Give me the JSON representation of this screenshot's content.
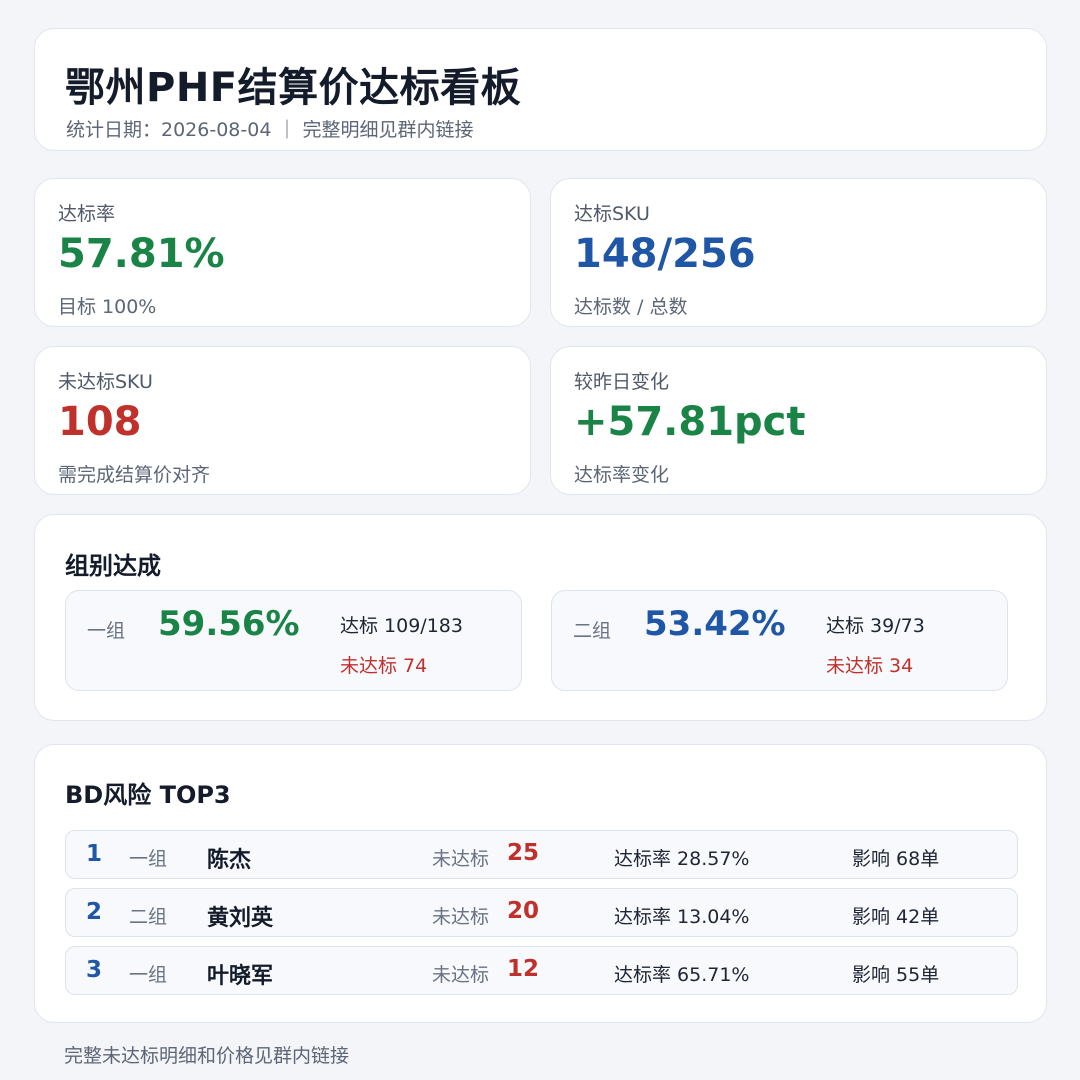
{
  "header": {
    "title": "鄂州PHF结算价达标看板",
    "subtitle": "统计日期：2026-08-04 ｜ 完整明细见群内链接"
  },
  "stats": [
    {
      "label": "达标率",
      "value": "57.81%",
      "note": "目标 100%",
      "color": "#1a8447"
    },
    {
      "label": "达标SKU",
      "value": "148/256",
      "note": "达标数 / 总数",
      "color": "#1f56a5"
    },
    {
      "label": "未达标SKU",
      "value": "108",
      "note": "需完成结算价对齐",
      "color": "#c0312c"
    },
    {
      "label": "较昨日变化",
      "value": "+57.81pct",
      "note": "达标率变化",
      "color": "#1a8447"
    }
  ],
  "groups": {
    "title": "组别达成",
    "items": [
      {
        "name": "一组",
        "rate": "59.56%",
        "done": "达标 109/183",
        "miss": "未达标 74",
        "color": "#1a8447"
      },
      {
        "name": "二组",
        "rate": "53.42%",
        "done": "达标 39/73",
        "miss": "未达标 34",
        "color": "#1f56a5"
      }
    ]
  },
  "risk": {
    "title": "BD风险 TOP3",
    "miss_label": "未达标",
    "rows": [
      {
        "rank": "1",
        "group": "一组",
        "name": "陈杰",
        "miss": "25",
        "rate": "达标率 28.57%",
        "impact": "影响 68单"
      },
      {
        "rank": "2",
        "group": "二组",
        "name": "黄刘英",
        "miss": "20",
        "rate": "达标率 13.04%",
        "impact": "影响 42单"
      },
      {
        "rank": "3",
        "group": "一组",
        "name": "叶晓军",
        "miss": "12",
        "rate": "达标率 65.71%",
        "impact": "影响 55单"
      }
    ]
  },
  "footer": "完整未达标明细和价格见群内链接"
}
